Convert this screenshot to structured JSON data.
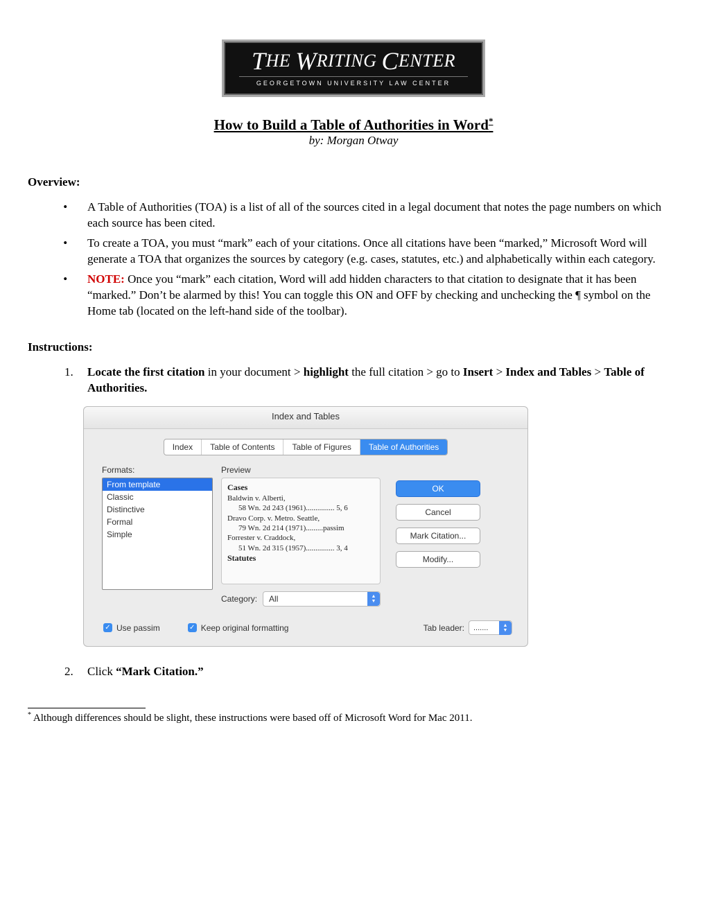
{
  "logo": {
    "main_html": "THE WRITING CENTER",
    "sub": "GEORGETOWN UNIVERSITY LAW CENTER"
  },
  "title": "How to Build a Table of Authorities in Word",
  "title_marker": "*",
  "byline": "by: Morgan Otway",
  "overview_head": "Overview:",
  "overview": {
    "b1": "A Table of Authorities (TOA) is a list of all of the sources cited in a legal document that notes the page numbers on which each source has been cited.",
    "b2": "To create a TOA, you must “mark” each of your citations. Once all citations have been “marked,” Microsoft Word will generate a TOA that organizes the sources by category (e.g. cases, statutes, etc.) and alphabetically within each category.",
    "b3_label": "NOTE:",
    "b3": " Once you “mark” each citation, Word will add hidden characters to that citation to designate that it has been “marked.” Don’t be alarmed by this! You can toggle this ON and OFF by checking and unchecking the ¶ symbol on the Home tab (located on the left-hand side of the toolbar)."
  },
  "instructions_head": "Instructions:",
  "step1": {
    "p1": "Locate the first citation",
    "p2": " in your document > ",
    "p3": "highlight",
    "p4": " the full citation > go to ",
    "p5": "Insert",
    "gt": " > ",
    "p6": "Index and Tables",
    "p7": "Table of Authorities."
  },
  "step2": {
    "pref": "Click ",
    "bold": "“Mark Citation.”"
  },
  "dialog": {
    "title": "Index and Tables",
    "tabs": [
      "Index",
      "Table of Contents",
      "Table of Figures",
      "Table of Authorities"
    ],
    "formats_label": "Formats:",
    "formats": [
      "From template",
      "Classic",
      "Distinctive",
      "Formal",
      "Simple"
    ],
    "preview_label": "Preview",
    "preview": {
      "h1": "Cases",
      "l1": "Baldwin v. Alberti,",
      "l1a": "58 Wn. 2d 243 (1961)............... 5, 6",
      "l2": "Dravo Corp. v. Metro. Seattle,",
      "l2a": "79 Wn. 2d 214 (1971).........passim",
      "l3": "Forrester v. Craddock,",
      "l3a": "51 Wn. 2d 315 (1957)............... 3, 4",
      "h2": "Statutes"
    },
    "category_label": "Category:",
    "category_value": "All",
    "buttons": {
      "ok": "OK",
      "cancel": "Cancel",
      "mark": "Mark Citation...",
      "modify": "Modify..."
    },
    "chk_passim": "Use passim",
    "chk_keep": "Keep original formatting",
    "tab_leader_label": "Tab leader:",
    "tab_leader_value": "......."
  },
  "footnote_marker": "*",
  "footnote": " Although differences should be slight, these instructions were based off of Microsoft Word for Mac 2011."
}
